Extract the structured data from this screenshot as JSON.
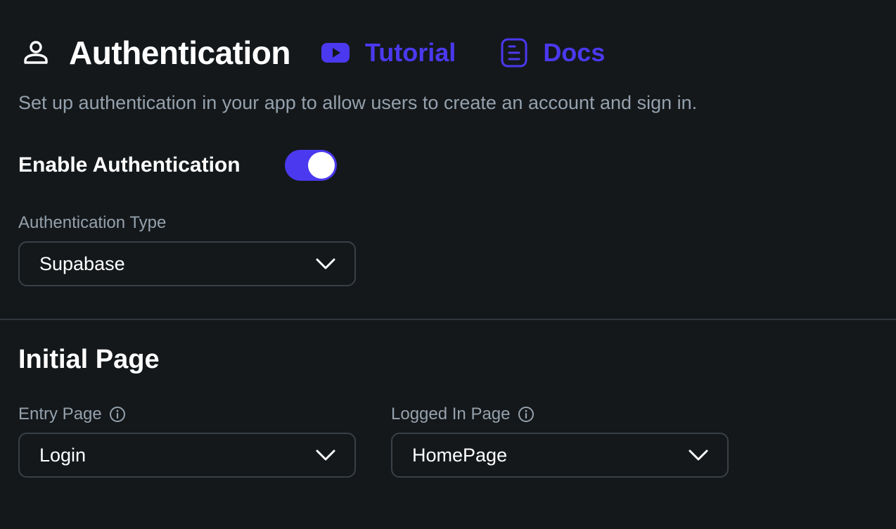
{
  "header": {
    "title": "Authentication",
    "icon": "user-icon",
    "tutorial_label": "Tutorial",
    "tutorial_icon": "youtube-play-icon",
    "docs_label": "Docs",
    "docs_icon": "document-icon"
  },
  "subtitle": "Set up authentication in your app to allow users to create an account and sign in.",
  "enable": {
    "label": "Enable Authentication",
    "enabled": true
  },
  "auth_type": {
    "label": "Authentication Type",
    "value": "Supabase"
  },
  "initial_page": {
    "title": "Initial Page",
    "entry_page": {
      "label": "Entry Page",
      "value": "Login"
    },
    "logged_in_page": {
      "label": "Logged In Page",
      "value": "HomePage"
    }
  },
  "colors": {
    "background": "#14181b",
    "accent": "#4b39ef",
    "secondary_text": "#95a1ac",
    "border": "#3a4047"
  }
}
